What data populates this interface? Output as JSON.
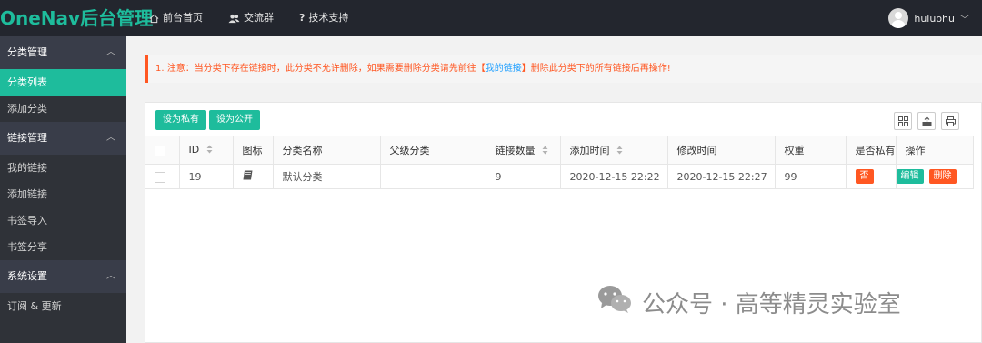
{
  "header": {
    "logo": "OneNav后台管理",
    "nav": [
      {
        "label": "前台首页",
        "icon": "home-icon"
      },
      {
        "label": "交流群",
        "icon": "users-icon"
      },
      {
        "label": "技术支持",
        "icon": "question-icon"
      }
    ],
    "username": "huluohu",
    "user_chevron": "﹀"
  },
  "sidebar": {
    "groups": [
      {
        "label": "分类管理",
        "items": [
          "分类列表",
          "添加分类"
        ]
      },
      {
        "label": "链接管理",
        "items": [
          "我的链接",
          "添加链接",
          "书签导入",
          "书签分享"
        ]
      },
      {
        "label": "系统设置",
        "items": [
          "订阅 & 更新"
        ]
      }
    ],
    "active_item": "分类列表",
    "arrow": "︿"
  },
  "notice": {
    "prefix": "1. 注意：当分类下存在链接时，此分类不允许删除，如果需要删除分类请先前往【",
    "link": "我的链接",
    "suffix": "】删除此分类下的所有链接后再操作!"
  },
  "toolbar": {
    "set_private": "设为私有",
    "set_public": "设为公开",
    "icons": [
      "columns-icon",
      "export-icon",
      "print-icon"
    ]
  },
  "table": {
    "columns": [
      "ID",
      "图标",
      "分类名称",
      "父级分类",
      "链接数量",
      "添加时间",
      "修改时间",
      "权重",
      "是否私有",
      "操作"
    ],
    "rows": [
      {
        "id": "19",
        "icon": "book-icon",
        "name": "默认分类",
        "parent": "",
        "link_count": "9",
        "created": "2020-12-15 22:22",
        "modified": "2020-12-15 22:27",
        "weight": "99",
        "private": "否",
        "edit": "编辑",
        "delete": "删除"
      }
    ]
  },
  "watermark": "公众号 · 高等精灵实验室",
  "colors": {
    "accent": "#1ebc9c",
    "header_bg": "#23262e",
    "sidebar_bg": "#2f3238",
    "sidebar_group_bg": "#393d49",
    "warning": "#ff5722",
    "link": "#1e9fff"
  }
}
